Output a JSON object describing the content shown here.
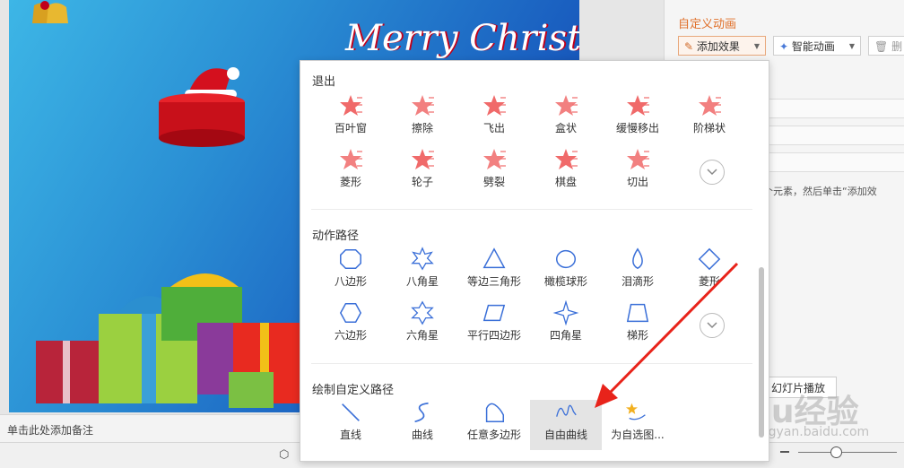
{
  "slide": {
    "title": "Merry Christmas",
    "notes_placeholder": "单击此处添加备注"
  },
  "task_pane": {
    "title": "自定义动画",
    "add_effect": "添加效果",
    "smart_animation": "智能动画",
    "delete": "删",
    "hint": "个元素，然后单击“添加效",
    "play": "幻灯片播放"
  },
  "watermark": {
    "brand": "Baidu经验",
    "url": "jingyan.baidu.com"
  },
  "popup": {
    "exit": {
      "title": "退出",
      "row1": [
        "百叶窗",
        "擦除",
        "飞出",
        "盒状",
        "缓慢移出",
        "阶梯状"
      ],
      "row2": [
        "菱形",
        "轮子",
        "劈裂",
        "棋盘",
        "切出"
      ]
    },
    "motion": {
      "title": "动作路径",
      "row1": [
        "八边形",
        "八角星",
        "等边三角形",
        "橄榄球形",
        "泪滴形",
        "菱形"
      ],
      "row2": [
        "六边形",
        "六角星",
        "平行四边形",
        "四角星",
        "梯形"
      ]
    },
    "custom": {
      "title": "绘制自定义路径",
      "items": [
        "直线",
        "曲线",
        "任意多边形",
        "自由曲线",
        "为自选图..."
      ]
    }
  },
  "colors": {
    "accent": "#e0702a",
    "path": "#3a6fd8",
    "arrow": "#e8231a",
    "exit_icon": "#f06a6a"
  },
  "icons": {
    "exit": "star-burst-icon",
    "more": "chevron-down-icon"
  }
}
